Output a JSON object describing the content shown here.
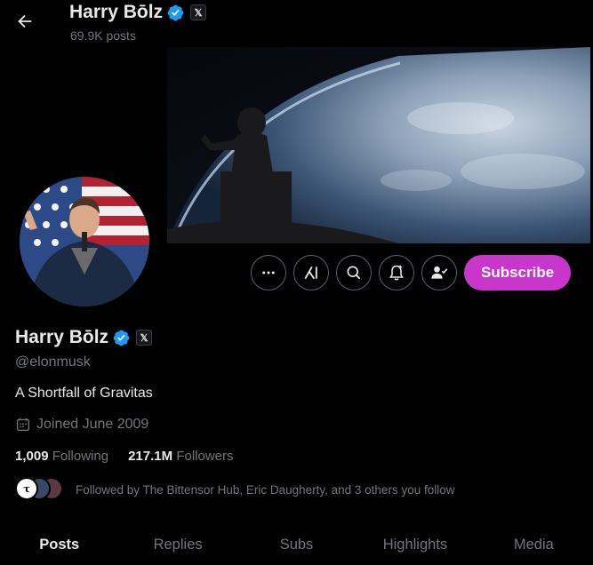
{
  "header": {
    "title": "Harry Bōlz",
    "posts_count": "69.9K posts"
  },
  "profile": {
    "name": "Harry Bōlz",
    "handle": "@elonmusk",
    "bio": "A Shortfall of Gravitas",
    "joined": "Joined June 2009",
    "following_count": "1,009",
    "following_label": "Following",
    "followers_count": "217.1M",
    "followers_label": "Followers",
    "followed_by": "Followed by The Bittensor Hub, Eric Daugherty, and 3 others you follow"
  },
  "badge": {
    "x_label": "𝕏"
  },
  "actions": {
    "more_icon": "more-icon",
    "grok_icon": "grok-icon",
    "search_icon": "search-icon",
    "notify_icon": "notification-bell-icon",
    "follow_icon": "person-check-icon",
    "subscribe_label": "Subscribe"
  },
  "tabs": [
    {
      "label": "Posts",
      "active": true
    },
    {
      "label": "Replies",
      "active": false
    },
    {
      "label": "Subs",
      "active": false
    },
    {
      "label": "Highlights",
      "active": false
    },
    {
      "label": "Media",
      "active": false
    }
  ],
  "colors": {
    "background": "#000000",
    "verified_blue": "#1d9bf0",
    "subscribe_bg": "#c936cc",
    "muted_text": "#71767b"
  }
}
